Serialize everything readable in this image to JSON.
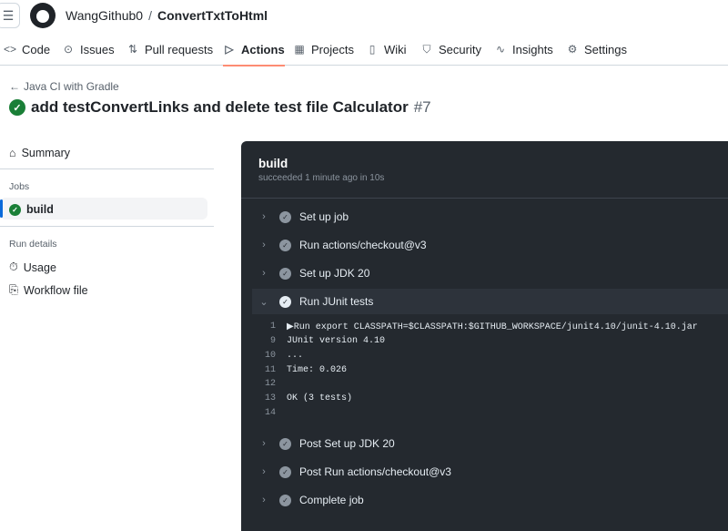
{
  "header": {
    "owner": "WangGithub0",
    "separator": "/",
    "repo": "ConvertTxtToHtml"
  },
  "tabs": [
    {
      "label": "Code",
      "icon": "code-icon",
      "glyph": "<>"
    },
    {
      "label": "Issues",
      "icon": "issue-icon",
      "glyph": "⊙"
    },
    {
      "label": "Pull requests",
      "icon": "pull-request-icon",
      "glyph": "⇅"
    },
    {
      "label": "Actions",
      "icon": "play-icon",
      "glyph": "▷"
    },
    {
      "label": "Projects",
      "icon": "table-icon",
      "glyph": "▦"
    },
    {
      "label": "Wiki",
      "icon": "book-icon",
      "glyph": "▯"
    },
    {
      "label": "Security",
      "icon": "shield-icon",
      "glyph": "⛉"
    },
    {
      "label": "Insights",
      "icon": "graph-icon",
      "glyph": "∿"
    },
    {
      "label": "Settings",
      "icon": "gear-icon",
      "glyph": "⚙"
    }
  ],
  "run": {
    "back_label": "Java CI with Gradle",
    "title": "add testConvertLinks and delete test file Calculator",
    "number": "#7"
  },
  "sidebar": {
    "summary": "Summary",
    "jobs_heading": "Jobs",
    "job_build": "build",
    "run_details_heading": "Run details",
    "usage": "Usage",
    "workflow_file": "Workflow file"
  },
  "job": {
    "title": "build",
    "subtitle": "succeeded 1 minute ago in 10s"
  },
  "steps": [
    {
      "label": "Set up job"
    },
    {
      "label": "Run actions/checkout@v3"
    },
    {
      "label": "Set up JDK 20"
    },
    {
      "label": "Run JUnit tests"
    },
    {
      "label": "Post Set up JDK 20"
    },
    {
      "label": "Post Run actions/checkout@v3"
    },
    {
      "label": "Complete job"
    }
  ],
  "log": [
    {
      "num": "1",
      "text": "▶Run export CLASSPATH=$CLASSPATH:$GITHUB_WORKSPACE/junit4.10/junit-4.10.jar"
    },
    {
      "num": "9",
      "text": "JUnit version 4.10"
    },
    {
      "num": "10",
      "text": "..."
    },
    {
      "num": "11",
      "text": "Time: 0.026"
    },
    {
      "num": "12",
      "text": ""
    },
    {
      "num": "13",
      "text": "OK (3 tests)"
    },
    {
      "num": "14",
      "text": ""
    }
  ],
  "colors": {
    "success": "#1a7f37",
    "active_tab_underline": "#fd8c73",
    "log_background": "#24292f"
  }
}
